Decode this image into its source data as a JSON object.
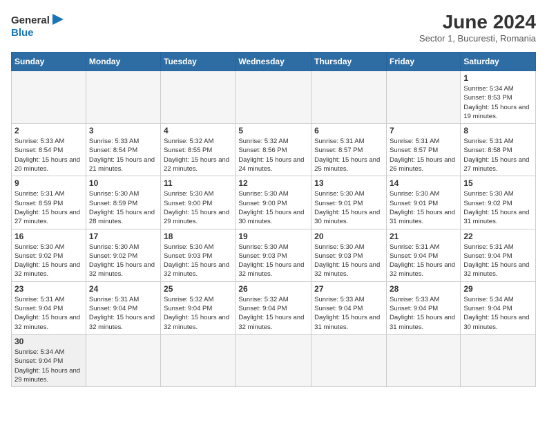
{
  "header": {
    "logo_general": "General",
    "logo_blue": "Blue",
    "month_year": "June 2024",
    "subtitle": "Sector 1, Bucuresti, Romania"
  },
  "days_of_week": [
    "Sunday",
    "Monday",
    "Tuesday",
    "Wednesday",
    "Thursday",
    "Friday",
    "Saturday"
  ],
  "weeks": [
    [
      {
        "day": "",
        "info": ""
      },
      {
        "day": "",
        "info": ""
      },
      {
        "day": "",
        "info": ""
      },
      {
        "day": "",
        "info": ""
      },
      {
        "day": "",
        "info": ""
      },
      {
        "day": "",
        "info": ""
      },
      {
        "day": "1",
        "info": "Sunrise: 5:34 AM\nSunset: 8:53 PM\nDaylight: 15 hours\nand 19 minutes."
      }
    ],
    [
      {
        "day": "2",
        "info": "Sunrise: 5:33 AM\nSunset: 8:54 PM\nDaylight: 15 hours\nand 20 minutes."
      },
      {
        "day": "3",
        "info": "Sunrise: 5:33 AM\nSunset: 8:54 PM\nDaylight: 15 hours\nand 21 minutes."
      },
      {
        "day": "4",
        "info": "Sunrise: 5:32 AM\nSunset: 8:55 PM\nDaylight: 15 hours\nand 22 minutes."
      },
      {
        "day": "5",
        "info": "Sunrise: 5:32 AM\nSunset: 8:56 PM\nDaylight: 15 hours\nand 24 minutes."
      },
      {
        "day": "6",
        "info": "Sunrise: 5:31 AM\nSunset: 8:57 PM\nDaylight: 15 hours\nand 25 minutes."
      },
      {
        "day": "7",
        "info": "Sunrise: 5:31 AM\nSunset: 8:57 PM\nDaylight: 15 hours\nand 26 minutes."
      },
      {
        "day": "8",
        "info": "Sunrise: 5:31 AM\nSunset: 8:58 PM\nDaylight: 15 hours\nand 27 minutes."
      }
    ],
    [
      {
        "day": "9",
        "info": "Sunrise: 5:31 AM\nSunset: 8:59 PM\nDaylight: 15 hours\nand 27 minutes."
      },
      {
        "day": "10",
        "info": "Sunrise: 5:30 AM\nSunset: 8:59 PM\nDaylight: 15 hours\nand 28 minutes."
      },
      {
        "day": "11",
        "info": "Sunrise: 5:30 AM\nSunset: 9:00 PM\nDaylight: 15 hours\nand 29 minutes."
      },
      {
        "day": "12",
        "info": "Sunrise: 5:30 AM\nSunset: 9:00 PM\nDaylight: 15 hours\nand 30 minutes."
      },
      {
        "day": "13",
        "info": "Sunrise: 5:30 AM\nSunset: 9:01 PM\nDaylight: 15 hours\nand 30 minutes."
      },
      {
        "day": "14",
        "info": "Sunrise: 5:30 AM\nSunset: 9:01 PM\nDaylight: 15 hours\nand 31 minutes."
      },
      {
        "day": "15",
        "info": "Sunrise: 5:30 AM\nSunset: 9:02 PM\nDaylight: 15 hours\nand 31 minutes."
      }
    ],
    [
      {
        "day": "16",
        "info": "Sunrise: 5:30 AM\nSunset: 9:02 PM\nDaylight: 15 hours\nand 32 minutes."
      },
      {
        "day": "17",
        "info": "Sunrise: 5:30 AM\nSunset: 9:02 PM\nDaylight: 15 hours\nand 32 minutes."
      },
      {
        "day": "18",
        "info": "Sunrise: 5:30 AM\nSunset: 9:03 PM\nDaylight: 15 hours\nand 32 minutes."
      },
      {
        "day": "19",
        "info": "Sunrise: 5:30 AM\nSunset: 9:03 PM\nDaylight: 15 hours\nand 32 minutes."
      },
      {
        "day": "20",
        "info": "Sunrise: 5:30 AM\nSunset: 9:03 PM\nDaylight: 15 hours\nand 32 minutes."
      },
      {
        "day": "21",
        "info": "Sunrise: 5:31 AM\nSunset: 9:04 PM\nDaylight: 15 hours\nand 32 minutes."
      },
      {
        "day": "22",
        "info": "Sunrise: 5:31 AM\nSunset: 9:04 PM\nDaylight: 15 hours\nand 32 minutes."
      }
    ],
    [
      {
        "day": "23",
        "info": "Sunrise: 5:31 AM\nSunset: 9:04 PM\nDaylight: 15 hours\nand 32 minutes."
      },
      {
        "day": "24",
        "info": "Sunrise: 5:31 AM\nSunset: 9:04 PM\nDaylight: 15 hours\nand 32 minutes."
      },
      {
        "day": "25",
        "info": "Sunrise: 5:32 AM\nSunset: 9:04 PM\nDaylight: 15 hours\nand 32 minutes."
      },
      {
        "day": "26",
        "info": "Sunrise: 5:32 AM\nSunset: 9:04 PM\nDaylight: 15 hours\nand 32 minutes."
      },
      {
        "day": "27",
        "info": "Sunrise: 5:33 AM\nSunset: 9:04 PM\nDaylight: 15 hours\nand 31 minutes."
      },
      {
        "day": "28",
        "info": "Sunrise: 5:33 AM\nSunset: 9:04 PM\nDaylight: 15 hours\nand 31 minutes."
      },
      {
        "day": "29",
        "info": "Sunrise: 5:34 AM\nSunset: 9:04 PM\nDaylight: 15 hours\nand 30 minutes."
      }
    ],
    [
      {
        "day": "30",
        "info": "Sunrise: 5:34 AM\nSunset: 9:04 PM\nDaylight: 15 hours\nand 29 minutes."
      },
      {
        "day": "",
        "info": ""
      },
      {
        "day": "",
        "info": ""
      },
      {
        "day": "",
        "info": ""
      },
      {
        "day": "",
        "info": ""
      },
      {
        "day": "",
        "info": ""
      },
      {
        "day": "",
        "info": ""
      }
    ]
  ]
}
